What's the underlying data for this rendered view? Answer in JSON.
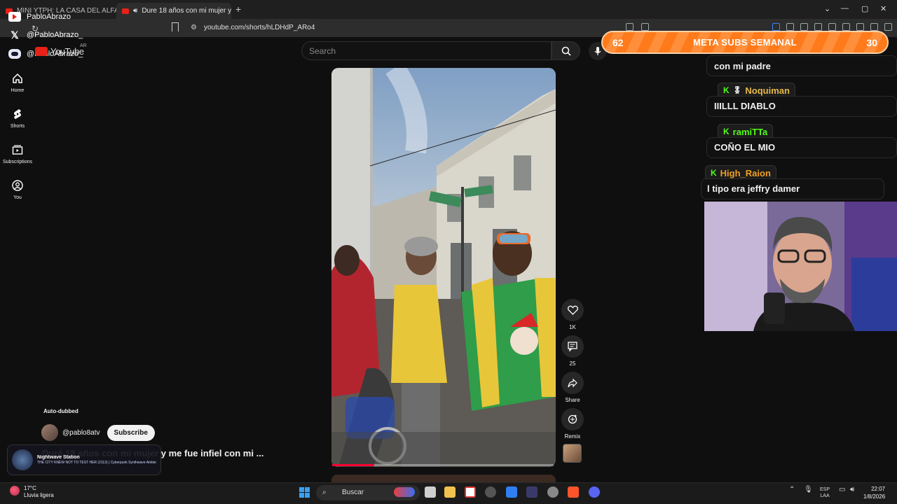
{
  "browser": {
    "tabs": [
      {
        "label": "MINI YTPH: LA CASA DEL ALFAJOR"
      },
      {
        "label": "Dure 18 años con mi mujer y"
      }
    ],
    "new_tab": "+",
    "url": "youtube.com/shorts/hLDHdP_ARo4"
  },
  "overlay": {
    "socials": [
      {
        "platform": "youtube-icon",
        "handle": "PabloAbrazo"
      },
      {
        "platform": "x-icon",
        "handle": "@PabloAbrazo_"
      },
      {
        "platform": "discord-icon",
        "handle": "@PabloAbrazo_"
      }
    ],
    "yt_logo": "YouTube",
    "yt_region": "AR"
  },
  "youtube": {
    "nav": [
      {
        "label": "Home"
      },
      {
        "label": "Shorts"
      },
      {
        "label": "Subscriptions"
      },
      {
        "label": "You"
      }
    ],
    "search_placeholder": "Search",
    "actions": [
      {
        "icon": "heart-icon",
        "label": "1K"
      },
      {
        "icon": "comment-icon",
        "label": "25"
      },
      {
        "icon": "share-icon",
        "label": "Share"
      },
      {
        "icon": "remix-icon",
        "label": "Remix"
      }
    ],
    "auto_dubbed": "Auto-dubbed",
    "channel": "@pablo8atv",
    "subscribe": "Subscribe",
    "title": "Duré 18 años con mi mujer y me fue infiel con mi ...",
    "progress": 0.19
  },
  "now_playing": {
    "title": "Nightwave Station",
    "subtitle": "THE CITY KNEW NOT TO TEST HER (2113) | Cyberpunk Synthwave Ambient"
  },
  "goal": {
    "label": "META SUBS SEMANAL",
    "current": "62",
    "target": "30"
  },
  "chat": [
    {
      "name": "",
      "message": "con mi padre",
      "color": "#ffffff"
    },
    {
      "name": "Noquiman",
      "message": "IIILLL DIABLO",
      "color": "#e8b84a"
    },
    {
      "name": "ramiTTa",
      "message": "COÑO EL MIO",
      "color": "#53fc18"
    },
    {
      "name": "High_Raion",
      "message": "l tipo era jeffry damer",
      "color": "#f0a020"
    }
  ],
  "taskbar": {
    "temp": "17°C",
    "weather": "Lluvia ligera",
    "search": "Buscar",
    "lang1": "ESP",
    "lang2": "LAA",
    "time": "22:07",
    "date": "1/8/2026"
  }
}
